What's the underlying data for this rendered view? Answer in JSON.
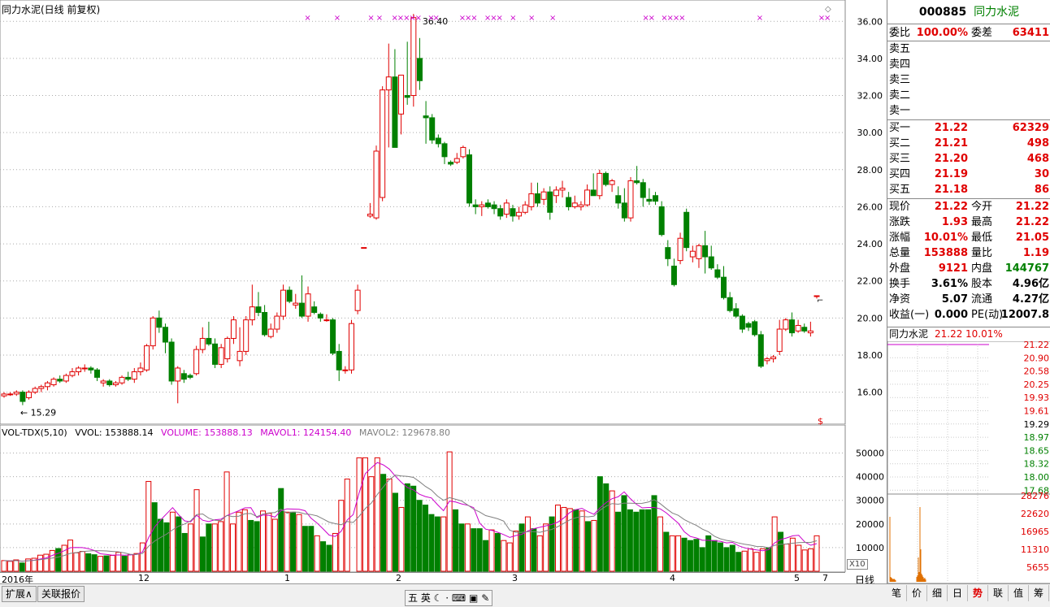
{
  "header": {
    "title": "同力水泥(日线 前复权)"
  },
  "stock": {
    "code": "000885",
    "name": "同力水泥"
  },
  "quote": {
    "weibi_label": "委比",
    "weibi": "100.00%",
    "weicha_label": "委差",
    "weicha": "63411",
    "sell": [
      {
        "label": "卖五"
      },
      {
        "label": "卖四"
      },
      {
        "label": "卖三"
      },
      {
        "label": "卖二"
      },
      {
        "label": "卖一"
      }
    ],
    "buy": [
      {
        "label": "买一",
        "price": "21.22",
        "vol": "62329"
      },
      {
        "label": "买二",
        "price": "21.21",
        "vol": "498"
      },
      {
        "label": "买三",
        "price": "21.20",
        "vol": "468"
      },
      {
        "label": "买四",
        "price": "21.19",
        "vol": "30"
      },
      {
        "label": "买五",
        "price": "21.18",
        "vol": "86"
      }
    ],
    "stats": [
      {
        "l1": "现价",
        "v1": "21.22",
        "c1": "red",
        "l2": "今开",
        "v2": "21.22",
        "c2": "red"
      },
      {
        "l1": "涨跌",
        "v1": "1.93",
        "c1": "red",
        "l2": "最高",
        "v2": "21.22",
        "c2": "red"
      },
      {
        "l1": "涨幅",
        "v1": "10.01%",
        "c1": "red",
        "l2": "最低",
        "v2": "21.05",
        "c2": "red"
      },
      {
        "l1": "总量",
        "v1": "153888",
        "c1": "red",
        "l2": "量比",
        "v2": "1.19",
        "c2": "red"
      },
      {
        "l1": "外盘",
        "v1": "9121",
        "c1": "red",
        "l2": "内盘",
        "v2": "144767",
        "c2": "green"
      },
      {
        "l1": "换手",
        "v1": "3.61%",
        "c1": "blk",
        "l2": "股本",
        "v2": "4.96亿",
        "c2": "blk"
      },
      {
        "l1": "净资",
        "v1": "5.07",
        "c1": "blk",
        "l2": "流通",
        "v2": "4.27亿",
        "c2": "blk"
      },
      {
        "l1": "收益(一)",
        "v1": "0.000",
        "c1": "blk",
        "l2": "PE(动)",
        "v2": "12007.8",
        "c2": "blk"
      }
    ]
  },
  "mini": {
    "name": "同力水泥",
    "price": "21.22",
    "pct": "10.01%",
    "price_ticks": [
      "21.22",
      "20.90",
      "20.58",
      "20.25",
      "19.93",
      "19.61",
      "19.29",
      "18.97",
      "18.65",
      "18.32",
      "18.00",
      "17.68"
    ],
    "vol_ticks": [
      "28276",
      "22620",
      "16965",
      "11310",
      "5655"
    ]
  },
  "volume_legend": {
    "name": "VOL-TDX(5,10)",
    "vvol": "VVOL: 153888.14",
    "volume": "VOLUME: 153888.13",
    "mavol1": "MAVOL1: 124154.40",
    "mavol2": "MAVOL2: 129678.80"
  },
  "annotations": {
    "high": "36.40",
    "low": "15.29",
    "x10": "X10",
    "period": "日线"
  },
  "date_axis": [
    "2016年",
    "12",
    "1",
    "2",
    "3",
    "4",
    "5",
    "7"
  ],
  "bottom": {
    "expand": "扩展∧",
    "related": "关联报价",
    "ime_label": "五 英",
    "tabs": [
      "笔",
      "价",
      "细",
      "日",
      "势",
      "联",
      "值",
      "筹"
    ]
  },
  "colors": {
    "up": "#e00000",
    "down": "#008000",
    "ma1": "#cc00cc",
    "ma2": "#808080",
    "marker": "#cc00cc"
  },
  "chart_data": [
    {
      "type": "candlestick",
      "title": "同力水泥(日线 前复权)",
      "ylim": [
        14.8,
        36.8
      ],
      "yticks": [
        16,
        18,
        20,
        22,
        24,
        26,
        28,
        30,
        32,
        34,
        36
      ],
      "series": [
        {
          "o": 15.8,
          "h": 16.0,
          "l": 15.7,
          "c": 15.9
        },
        {
          "o": 15.9,
          "h": 16.0,
          "l": 15.8,
          "c": 15.9
        },
        {
          "o": 15.9,
          "h": 16.1,
          "l": 15.8,
          "c": 16.0
        },
        {
          "o": 16.0,
          "h": 16.1,
          "l": 15.3,
          "c": 15.5
        },
        {
          "o": 15.7,
          "h": 16.1,
          "l": 15.6,
          "c": 16.0
        },
        {
          "o": 16.0,
          "h": 16.3,
          "l": 15.9,
          "c": 16.2
        },
        {
          "o": 16.2,
          "h": 16.4,
          "l": 16.0,
          "c": 16.3
        },
        {
          "o": 16.3,
          "h": 16.6,
          "l": 16.1,
          "c": 16.5
        },
        {
          "o": 16.4,
          "h": 16.8,
          "l": 16.3,
          "c": 16.7
        },
        {
          "o": 16.7,
          "h": 16.9,
          "l": 16.5,
          "c": 16.6
        },
        {
          "o": 16.6,
          "h": 17.0,
          "l": 16.5,
          "c": 16.9
        },
        {
          "o": 16.9,
          "h": 17.3,
          "l": 16.8,
          "c": 17.1
        },
        {
          "o": 17.1,
          "h": 17.4,
          "l": 16.9,
          "c": 17.3
        },
        {
          "o": 17.3,
          "h": 17.5,
          "l": 17.1,
          "c": 17.3
        },
        {
          "o": 17.3,
          "h": 17.4,
          "l": 17.0,
          "c": 17.2
        },
        {
          "o": 17.2,
          "h": 17.3,
          "l": 16.6,
          "c": 16.8
        },
        {
          "o": 16.5,
          "h": 16.7,
          "l": 16.3,
          "c": 16.6
        },
        {
          "o": 16.6,
          "h": 16.7,
          "l": 16.3,
          "c": 16.4
        },
        {
          "o": 16.4,
          "h": 16.6,
          "l": 16.3,
          "c": 16.5
        },
        {
          "o": 16.5,
          "h": 16.9,
          "l": 16.4,
          "c": 16.8
        },
        {
          "o": 16.8,
          "h": 17.1,
          "l": 16.6,
          "c": 16.7
        },
        {
          "o": 16.7,
          "h": 17.3,
          "l": 16.5,
          "c": 17.1
        },
        {
          "o": 17.1,
          "h": 17.6,
          "l": 16.9,
          "c": 17.3
        },
        {
          "o": 17.2,
          "h": 18.6,
          "l": 17.1,
          "c": 18.5
        },
        {
          "o": 18.5,
          "h": 20.1,
          "l": 18.3,
          "c": 20.0
        },
        {
          "o": 20.0,
          "h": 20.4,
          "l": 19.2,
          "c": 19.5
        },
        {
          "o": 19.5,
          "h": 19.7,
          "l": 18.1,
          "c": 18.7
        },
        {
          "o": 18.7,
          "h": 18.9,
          "l": 16.4,
          "c": 16.6
        },
        {
          "o": 16.6,
          "h": 17.4,
          "l": 15.4,
          "c": 17.3
        },
        {
          "o": 17.0,
          "h": 17.2,
          "l": 16.5,
          "c": 16.7
        },
        {
          "o": 16.9,
          "h": 17.0,
          "l": 16.7,
          "c": 16.8
        },
        {
          "o": 17.0,
          "h": 18.5,
          "l": 16.9,
          "c": 18.3
        },
        {
          "o": 18.3,
          "h": 19.5,
          "l": 18.1,
          "c": 18.9
        },
        {
          "o": 18.9,
          "h": 19.8,
          "l": 18.5,
          "c": 18.6
        },
        {
          "o": 18.6,
          "h": 18.9,
          "l": 17.3,
          "c": 17.5
        },
        {
          "o": 17.5,
          "h": 18.6,
          "l": 17.3,
          "c": 18.4
        },
        {
          "o": 17.8,
          "h": 19.0,
          "l": 17.6,
          "c": 18.9
        },
        {
          "o": 18.9,
          "h": 20.1,
          "l": 18.6,
          "c": 19.9
        },
        {
          "o": 17.7,
          "h": 19.5,
          "l": 17.4,
          "c": 18.2
        },
        {
          "o": 18.2,
          "h": 20.1,
          "l": 18.0,
          "c": 19.9
        },
        {
          "o": 19.9,
          "h": 21.8,
          "l": 19.6,
          "c": 20.6
        },
        {
          "o": 20.6,
          "h": 21.4,
          "l": 20.1,
          "c": 20.3
        },
        {
          "o": 20.3,
          "h": 20.7,
          "l": 19.0,
          "c": 19.1
        },
        {
          "o": 19.0,
          "h": 19.7,
          "l": 18.9,
          "c": 19.4
        },
        {
          "o": 19.4,
          "h": 20.3,
          "l": 19.2,
          "c": 20.1
        },
        {
          "o": 20.1,
          "h": 21.8,
          "l": 19.9,
          "c": 21.5
        },
        {
          "o": 21.5,
          "h": 21.7,
          "l": 20.8,
          "c": 20.9
        },
        {
          "o": 20.7,
          "h": 21.3,
          "l": 20.5,
          "c": 20.8
        },
        {
          "o": 20.8,
          "h": 22.3,
          "l": 20.0,
          "c": 20.1
        },
        {
          "o": 20.1,
          "h": 21.7,
          "l": 19.8,
          "c": 21.3
        },
        {
          "o": 20.6,
          "h": 20.9,
          "l": 20.2,
          "c": 20.3
        },
        {
          "o": 20.2,
          "h": 20.3,
          "l": 19.8,
          "c": 20.0
        },
        {
          "o": 19.9,
          "h": 20.2,
          "l": 19.8,
          "c": 19.9
        },
        {
          "o": 19.9,
          "h": 20.0,
          "l": 18.0,
          "c": 18.1
        },
        {
          "o": 18.2,
          "h": 18.6,
          "l": 16.6,
          "c": 17.2
        },
        {
          "o": 17.2,
          "h": 17.4,
          "l": 17.0,
          "c": 17.2
        },
        {
          "o": 17.2,
          "h": 19.9,
          "l": 17.0,
          "c": 19.7
        },
        {
          "o": 20.4,
          "h": 21.8,
          "l": 20.2,
          "c": 21.5
        },
        {
          "o": 23.8,
          "h": 23.8,
          "l": 23.8,
          "c": 23.8
        },
        {
          "o": 25.5,
          "h": 26.2,
          "l": 25.4,
          "c": 25.6
        },
        {
          "o": 25.4,
          "h": 29.3,
          "l": 25.3,
          "c": 29.0
        },
        {
          "o": 26.5,
          "h": 32.5,
          "l": 26.3,
          "c": 32.3
        },
        {
          "o": 32.3,
          "h": 34.8,
          "l": 29.2,
          "c": 33.0
        },
        {
          "o": 33.0,
          "h": 34.5,
          "l": 29.2,
          "c": 29.2
        },
        {
          "o": 31.0,
          "h": 33.0,
          "l": 29.9,
          "c": 33.1
        },
        {
          "o": 32.0,
          "h": 34.9,
          "l": 31.5,
          "c": 31.9
        },
        {
          "o": 32.0,
          "h": 36.4,
          "l": 31.4,
          "c": 36.2
        },
        {
          "o": 34.0,
          "h": 35.1,
          "l": 32.3,
          "c": 32.8
        },
        {
          "o": 30.9,
          "h": 31.7,
          "l": 29.4,
          "c": 30.8
        },
        {
          "o": 30.8,
          "h": 31.0,
          "l": 29.4,
          "c": 29.6
        },
        {
          "o": 29.7,
          "h": 29.9,
          "l": 29.2,
          "c": 29.4
        },
        {
          "o": 29.4,
          "h": 29.5,
          "l": 28.3,
          "c": 28.7
        },
        {
          "o": 28.4,
          "h": 28.5,
          "l": 28.2,
          "c": 28.3
        },
        {
          "o": 28.4,
          "h": 28.9,
          "l": 28.3,
          "c": 28.6
        },
        {
          "o": 28.7,
          "h": 29.3,
          "l": 28.6,
          "c": 29.2
        },
        {
          "o": 28.8,
          "h": 29.1,
          "l": 26.0,
          "c": 26.2
        },
        {
          "o": 26.1,
          "h": 26.4,
          "l": 25.6,
          "c": 26.0
        },
        {
          "o": 26.0,
          "h": 26.3,
          "l": 25.5,
          "c": 26.1
        },
        {
          "o": 26.2,
          "h": 26.4,
          "l": 25.9,
          "c": 26.0
        },
        {
          "o": 26.1,
          "h": 26.3,
          "l": 25.6,
          "c": 25.9
        },
        {
          "o": 25.9,
          "h": 26.1,
          "l": 25.3,
          "c": 25.5
        },
        {
          "o": 25.6,
          "h": 26.4,
          "l": 25.4,
          "c": 26.2
        },
        {
          "o": 25.9,
          "h": 26.1,
          "l": 25.2,
          "c": 25.5
        },
        {
          "o": 25.5,
          "h": 26.0,
          "l": 25.3,
          "c": 25.7
        },
        {
          "o": 25.7,
          "h": 26.3,
          "l": 25.6,
          "c": 26.1
        },
        {
          "o": 26.0,
          "h": 27.3,
          "l": 25.8,
          "c": 26.7
        },
        {
          "o": 26.7,
          "h": 27.3,
          "l": 26.0,
          "c": 26.2
        },
        {
          "o": 26.4,
          "h": 27.0,
          "l": 26.1,
          "c": 26.8
        },
        {
          "o": 26.8,
          "h": 27.1,
          "l": 25.3,
          "c": 25.7
        },
        {
          "o": 26.6,
          "h": 27.1,
          "l": 26.2,
          "c": 26.9
        },
        {
          "o": 26.9,
          "h": 27.4,
          "l": 26.5,
          "c": 27.0
        },
        {
          "o": 26.5,
          "h": 26.8,
          "l": 25.8,
          "c": 26.0
        },
        {
          "o": 26.0,
          "h": 26.6,
          "l": 25.9,
          "c": 26.2
        },
        {
          "o": 26.0,
          "h": 26.3,
          "l": 25.8,
          "c": 26.1
        },
        {
          "o": 26.1,
          "h": 27.2,
          "l": 26.0,
          "c": 26.9
        },
        {
          "o": 26.9,
          "h": 27.8,
          "l": 26.7,
          "c": 26.6
        },
        {
          "o": 26.6,
          "h": 28.0,
          "l": 26.4,
          "c": 27.8
        },
        {
          "o": 27.8,
          "h": 27.9,
          "l": 27.1,
          "c": 27.2
        },
        {
          "o": 27.2,
          "h": 27.5,
          "l": 26.8,
          "c": 27.4
        },
        {
          "o": 26.6,
          "h": 27.1,
          "l": 25.9,
          "c": 26.2
        },
        {
          "o": 26.2,
          "h": 27.0,
          "l": 25.2,
          "c": 25.4
        },
        {
          "o": 25.4,
          "h": 27.6,
          "l": 25.2,
          "c": 27.4
        },
        {
          "o": 27.4,
          "h": 28.2,
          "l": 27.2,
          "c": 27.3
        },
        {
          "o": 27.3,
          "h": 27.5,
          "l": 26.0,
          "c": 26.5
        },
        {
          "o": 26.4,
          "h": 27.0,
          "l": 26.1,
          "c": 26.3
        },
        {
          "o": 26.6,
          "h": 26.8,
          "l": 26.1,
          "c": 26.3
        },
        {
          "o": 26.0,
          "h": 26.3,
          "l": 24.4,
          "c": 24.5
        },
        {
          "o": 23.8,
          "h": 24.2,
          "l": 22.8,
          "c": 23.2
        },
        {
          "o": 22.8,
          "h": 23.2,
          "l": 21.7,
          "c": 21.8
        },
        {
          "o": 23.1,
          "h": 24.6,
          "l": 22.9,
          "c": 24.3
        },
        {
          "o": 25.7,
          "h": 25.9,
          "l": 23.6,
          "c": 23.8
        },
        {
          "o": 23.3,
          "h": 23.9,
          "l": 23.0,
          "c": 23.6
        },
        {
          "o": 23.2,
          "h": 24.0,
          "l": 22.7,
          "c": 23.9
        },
        {
          "o": 23.9,
          "h": 24.7,
          "l": 22.4,
          "c": 23.3
        },
        {
          "o": 23.3,
          "h": 23.9,
          "l": 22.6,
          "c": 22.7
        },
        {
          "o": 22.6,
          "h": 22.9,
          "l": 22.1,
          "c": 22.2
        },
        {
          "o": 22.2,
          "h": 22.8,
          "l": 21.0,
          "c": 21.1
        },
        {
          "o": 21.1,
          "h": 21.4,
          "l": 20.3,
          "c": 20.4
        },
        {
          "o": 20.5,
          "h": 20.8,
          "l": 20.0,
          "c": 20.1
        },
        {
          "o": 20.1,
          "h": 20.2,
          "l": 19.2,
          "c": 19.4
        },
        {
          "o": 19.7,
          "h": 19.8,
          "l": 19.3,
          "c": 19.5
        },
        {
          "o": 19.8,
          "h": 19.9,
          "l": 19.0,
          "c": 19.1
        },
        {
          "o": 19.1,
          "h": 19.3,
          "l": 17.3,
          "c": 17.4
        },
        {
          "o": 17.7,
          "h": 17.9,
          "l": 17.5,
          "c": 17.8
        },
        {
          "o": 17.8,
          "h": 18.0,
          "l": 17.6,
          "c": 17.9
        },
        {
          "o": 18.2,
          "h": 19.9,
          "l": 18.0,
          "c": 19.4
        },
        {
          "o": 19.4,
          "h": 20.0,
          "l": 19.3,
          "c": 19.9
        },
        {
          "o": 19.9,
          "h": 20.3,
          "l": 19.0,
          "c": 19.2
        },
        {
          "o": 19.3,
          "h": 19.9,
          "l": 19.2,
          "c": 19.6
        },
        {
          "o": 19.5,
          "h": 19.7,
          "l": 19.2,
          "c": 19.3
        },
        {
          "o": 19.2,
          "h": 19.8,
          "l": 19.0,
          "c": 19.3
        },
        {
          "o": 21.2,
          "h": 21.22,
          "l": 21.05,
          "c": 21.2
        }
      ],
      "high_label": "36.40",
      "low_label": "15.29"
    },
    {
      "type": "bar",
      "title": "VOL-TDX(5,10)",
      "ylim": [
        0,
        55000
      ],
      "yticks": [
        10000,
        20000,
        30000,
        40000,
        50000
      ],
      "values": [
        4500,
        4200,
        4800,
        3500,
        5200,
        5500,
        6800,
        7200,
        8800,
        9600,
        11000,
        13200,
        7800,
        8400,
        7400,
        7000,
        6300,
        6500,
        6700,
        8000,
        6400,
        7000,
        7500,
        12000,
        38000,
        29000,
        22000,
        20500,
        25000,
        23000,
        16000,
        20000,
        34500,
        14500,
        20000,
        20000,
        21000,
        42000,
        20000,
        25000,
        26000,
        21500,
        21000,
        25500,
        24500,
        22000,
        35000,
        25000,
        25000,
        24000,
        19000,
        19000,
        15000,
        12500,
        11000,
        16000,
        30000,
        39000,
        null,
        48000,
        48000,
        40000,
        48000,
        41000,
        39000,
        33000,
        27000,
        37000,
        36000,
        30000,
        28000,
        24000,
        23000,
        23000,
        50500,
        26000,
        20000,
        20000,
        18000,
        18000,
        13000,
        17500,
        16000,
        13000,
        12000,
        17000,
        20000,
        23000,
        18000,
        15000,
        20000,
        23000,
        28000,
        27000,
        26500,
        26000,
        25500,
        21000,
        21500,
        40000,
        37000,
        34000,
        25000,
        32000,
        26000,
        25000,
        26000,
        26000,
        32000,
        23000,
        16500,
        15000,
        15000,
        14000,
        13000,
        13500,
        10000,
        15000,
        13000,
        12000,
        10000,
        11000,
        8000,
        8500,
        9500,
        8000,
        9500,
        10000,
        23000,
        16500,
        11500,
        14000,
        11000,
        9000,
        9500,
        15000
      ],
      "mavol1_label": "MAVOL1: 124154.40",
      "mavol2_label": "MAVOL2: 129678.80"
    }
  ]
}
